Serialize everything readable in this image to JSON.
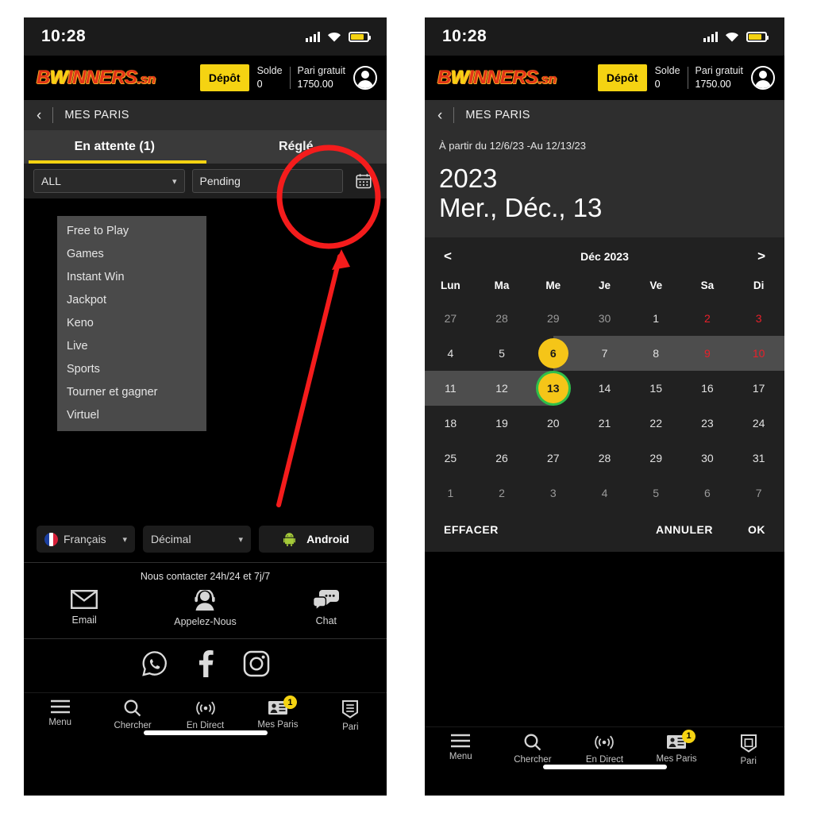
{
  "status": {
    "time": "10:28",
    "icons": [
      "signal-icon",
      "wifi-icon",
      "battery-icon"
    ]
  },
  "brand": {
    "logo_b": "B",
    "logo_w": "W",
    "logo_rest": "INNERS",
    "logo_tld": ".sn",
    "deposit_label": "Dépôt",
    "balance_label": "Solde",
    "balance_value": "0",
    "freebet_label": "Pari gratuit",
    "freebet_value": "1750.00"
  },
  "subheader": {
    "back": "‹",
    "title": "MES PARIS"
  },
  "tabs": {
    "pending": "En attente (1)",
    "settled": "Réglé"
  },
  "filter": {
    "select_value": "ALL",
    "status_value": "Pending",
    "status_placeholder": "Pending",
    "calendar_icon": "calendar-icon"
  },
  "dropdown": {
    "options": [
      "Free to Play",
      "Games",
      "Instant Win",
      "Jackpot",
      "Keno",
      "Live",
      "Sports",
      "Tourner et gagner",
      "Virtuel"
    ]
  },
  "selectors": {
    "language": "Français",
    "odds": "Décimal",
    "platform": "Android"
  },
  "contact": {
    "title": "Nous contacter 24h/24 et 7j/7",
    "items": [
      {
        "label": "Email",
        "icon": "envelope-icon"
      },
      {
        "label": "Appelez-Nous",
        "icon": "headset-agent-icon"
      },
      {
        "label": "Chat",
        "icon": "chat-bubbles-icon"
      }
    ]
  },
  "socials": [
    {
      "name": "whatsapp-icon"
    },
    {
      "name": "facebook-icon"
    },
    {
      "name": "instagram-icon"
    }
  ],
  "bottomnav": {
    "items": [
      {
        "label": "Menu",
        "icon": "hamburger-icon"
      },
      {
        "label": "Chercher",
        "icon": "search-icon"
      },
      {
        "label": "En Direct",
        "icon": "live-broadcast-icon"
      },
      {
        "label": "Mes Paris",
        "icon": "bet-slip-icon",
        "badge": "1"
      },
      {
        "label": "Pari",
        "icon": "ticket-shield-icon"
      }
    ]
  },
  "picker": {
    "range_text": "À partir du 12/6/23 -Au 12/13/23",
    "year": "2023",
    "date": "Mer., Déc., 13",
    "prev": "<",
    "next": ">",
    "month_label": "Déc 2023",
    "dow": [
      "Lun",
      "Ma",
      "Me",
      "Je",
      "Ve",
      "Sa",
      "Di"
    ],
    "weeks": [
      [
        {
          "n": "27",
          "out": true,
          "we": false
        },
        {
          "n": "28",
          "out": true,
          "we": false
        },
        {
          "n": "29",
          "out": true,
          "we": false
        },
        {
          "n": "30",
          "out": true,
          "we": false
        },
        {
          "n": "1",
          "out": false,
          "we": false
        },
        {
          "n": "2",
          "out": false,
          "we": true
        },
        {
          "n": "3",
          "out": false,
          "we": true
        }
      ],
      [
        {
          "n": "4",
          "out": false,
          "we": false
        },
        {
          "n": "5",
          "out": false,
          "we": false
        },
        {
          "n": "6",
          "out": false,
          "we": false,
          "sel": true,
          "range": "right"
        },
        {
          "n": "7",
          "out": false,
          "we": false,
          "range": "full"
        },
        {
          "n": "8",
          "out": false,
          "we": false,
          "range": "full"
        },
        {
          "n": "9",
          "out": false,
          "we": true,
          "range": "full"
        },
        {
          "n": "10",
          "out": false,
          "we": true,
          "range": "full"
        }
      ],
      [
        {
          "n": "11",
          "out": false,
          "we": false,
          "range": "full"
        },
        {
          "n": "12",
          "out": false,
          "we": false,
          "range": "full"
        },
        {
          "n": "13",
          "out": false,
          "we": false,
          "sel": true,
          "today": true,
          "range": "left"
        },
        {
          "n": "14",
          "out": false,
          "we": false
        },
        {
          "n": "15",
          "out": false,
          "we": false
        },
        {
          "n": "16",
          "out": false,
          "we": false
        },
        {
          "n": "17",
          "out": false,
          "we": false
        }
      ],
      [
        {
          "n": "18",
          "out": false,
          "we": false
        },
        {
          "n": "19",
          "out": false,
          "we": false
        },
        {
          "n": "20",
          "out": false,
          "we": false
        },
        {
          "n": "21",
          "out": false,
          "we": false
        },
        {
          "n": "22",
          "out": false,
          "we": false
        },
        {
          "n": "23",
          "out": false,
          "we": false
        },
        {
          "n": "24",
          "out": false,
          "we": false
        }
      ],
      [
        {
          "n": "25",
          "out": false,
          "we": false
        },
        {
          "n": "26",
          "out": false,
          "we": false
        },
        {
          "n": "27",
          "out": false,
          "we": false
        },
        {
          "n": "28",
          "out": false,
          "we": false
        },
        {
          "n": "29",
          "out": false,
          "we": false
        },
        {
          "n": "30",
          "out": false,
          "we": false
        },
        {
          "n": "31",
          "out": false,
          "we": false
        }
      ],
      [
        {
          "n": "1",
          "out": true,
          "we": false
        },
        {
          "n": "2",
          "out": true,
          "we": false
        },
        {
          "n": "3",
          "out": true,
          "we": false
        },
        {
          "n": "4",
          "out": true,
          "we": false
        },
        {
          "n": "5",
          "out": true,
          "we": false
        },
        {
          "n": "6",
          "out": true,
          "we": false
        },
        {
          "n": "7",
          "out": true,
          "we": false
        }
      ]
    ],
    "actions": {
      "clear": "EFFACER",
      "cancel": "ANNULER",
      "ok": "OK"
    }
  },
  "annotations": {
    "circle": "red-highlight-circle",
    "arrow": "red-pointer-arrow",
    "color": "#f41c1c"
  },
  "colors": {
    "accent_yellow": "#f5d312",
    "selected_yellow": "#f5c518",
    "today_green": "#2fbf4a",
    "weekend_red": "#e8202a",
    "annotation_red": "#f41c1c"
  }
}
